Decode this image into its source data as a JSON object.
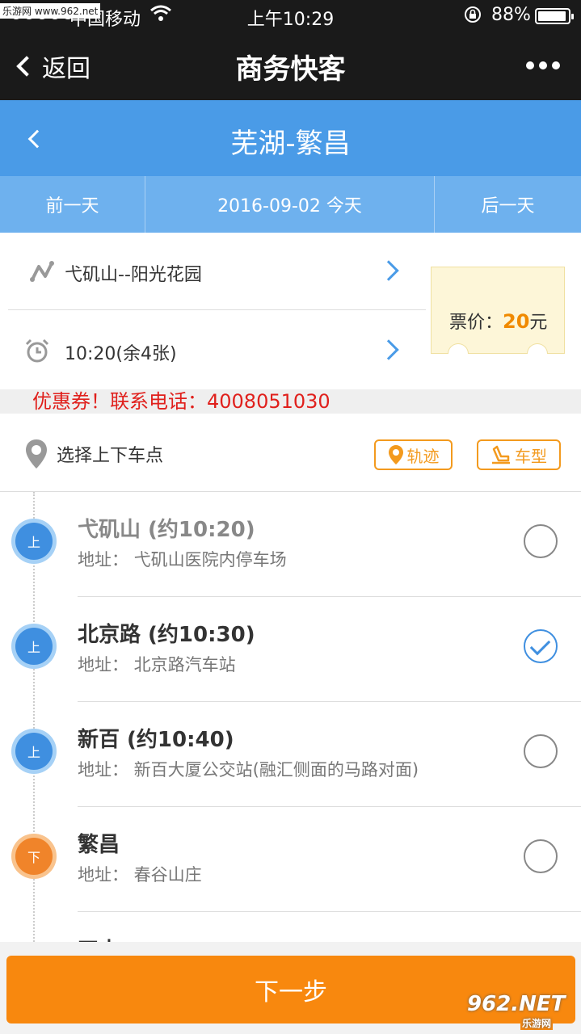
{
  "status_bar": {
    "watermark": "乐游网 www.962.net",
    "carrier": "中国移动",
    "time": "上午10:29",
    "battery": "88%"
  },
  "wechat_bar": {
    "back_label": "返回",
    "title": "商务快客"
  },
  "route": {
    "title": "芜湖-繁昌"
  },
  "day_bar": {
    "prev": "前一天",
    "today": "2016-09-02 今天",
    "next": "后一天"
  },
  "trip": {
    "line": "弋矶山--阳光花园",
    "departure": "10:20(余4张)"
  },
  "ticket": {
    "label": "票价：",
    "price": "20",
    "unit": "元"
  },
  "marquee": "优惠券！联系电话：4008051030",
  "stop_header": {
    "label": "选择上下车点",
    "track_button": "轨迹",
    "car_button": "车型"
  },
  "stops": [
    {
      "badge": "上",
      "name": "弋矶山 (约10:20)",
      "address": "地址：  弋矶山医院内停车场",
      "selected": false
    },
    {
      "badge": "上",
      "name": "北京路 (约10:30)",
      "address": "地址：  北京路汽车站",
      "selected": true
    },
    {
      "badge": "上",
      "name": "新百 (约10:40)",
      "address": "地址：  新百大厦公交站(融汇侧面的马路对面)",
      "selected": false
    },
    {
      "badge": "下",
      "name": "繁昌",
      "address": "地址：  春谷山庄",
      "selected": false
    }
  ],
  "partial_stop": "四中",
  "next_button": "下一步",
  "watermark_bottom": {
    "main": "962.NET",
    "sub": "乐游网"
  },
  "colors": {
    "blue": "#4a9be7",
    "orange": "#f8880e",
    "red_text": "#e0201c"
  }
}
